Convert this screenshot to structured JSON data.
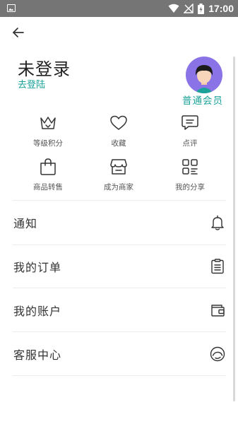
{
  "status_bar": {
    "time": "17:00"
  },
  "profile": {
    "username": "未登录",
    "login_link": "去登陆",
    "member_level": "普通会员"
  },
  "quick_actions": [
    {
      "label": "等级积分",
      "icon": "crown-icon"
    },
    {
      "label": "收藏",
      "icon": "heart-icon"
    },
    {
      "label": "点评",
      "icon": "comment-icon"
    },
    {
      "label": "商品转售",
      "icon": "bag-icon"
    },
    {
      "label": "成为商家",
      "icon": "store-icon"
    },
    {
      "label": "我的分享",
      "icon": "share-grid-icon"
    }
  ],
  "menu": [
    {
      "label": "通知",
      "icon": "bell-icon"
    },
    {
      "label": "我的订单",
      "icon": "clipboard-icon"
    },
    {
      "label": "我的账户",
      "icon": "wallet-icon"
    },
    {
      "label": "客服中心",
      "icon": "headset-icon"
    }
  ],
  "colors": {
    "accent": "#1aa29a",
    "avatar_bg": "#8a73e6",
    "status_bar": "#757575"
  }
}
